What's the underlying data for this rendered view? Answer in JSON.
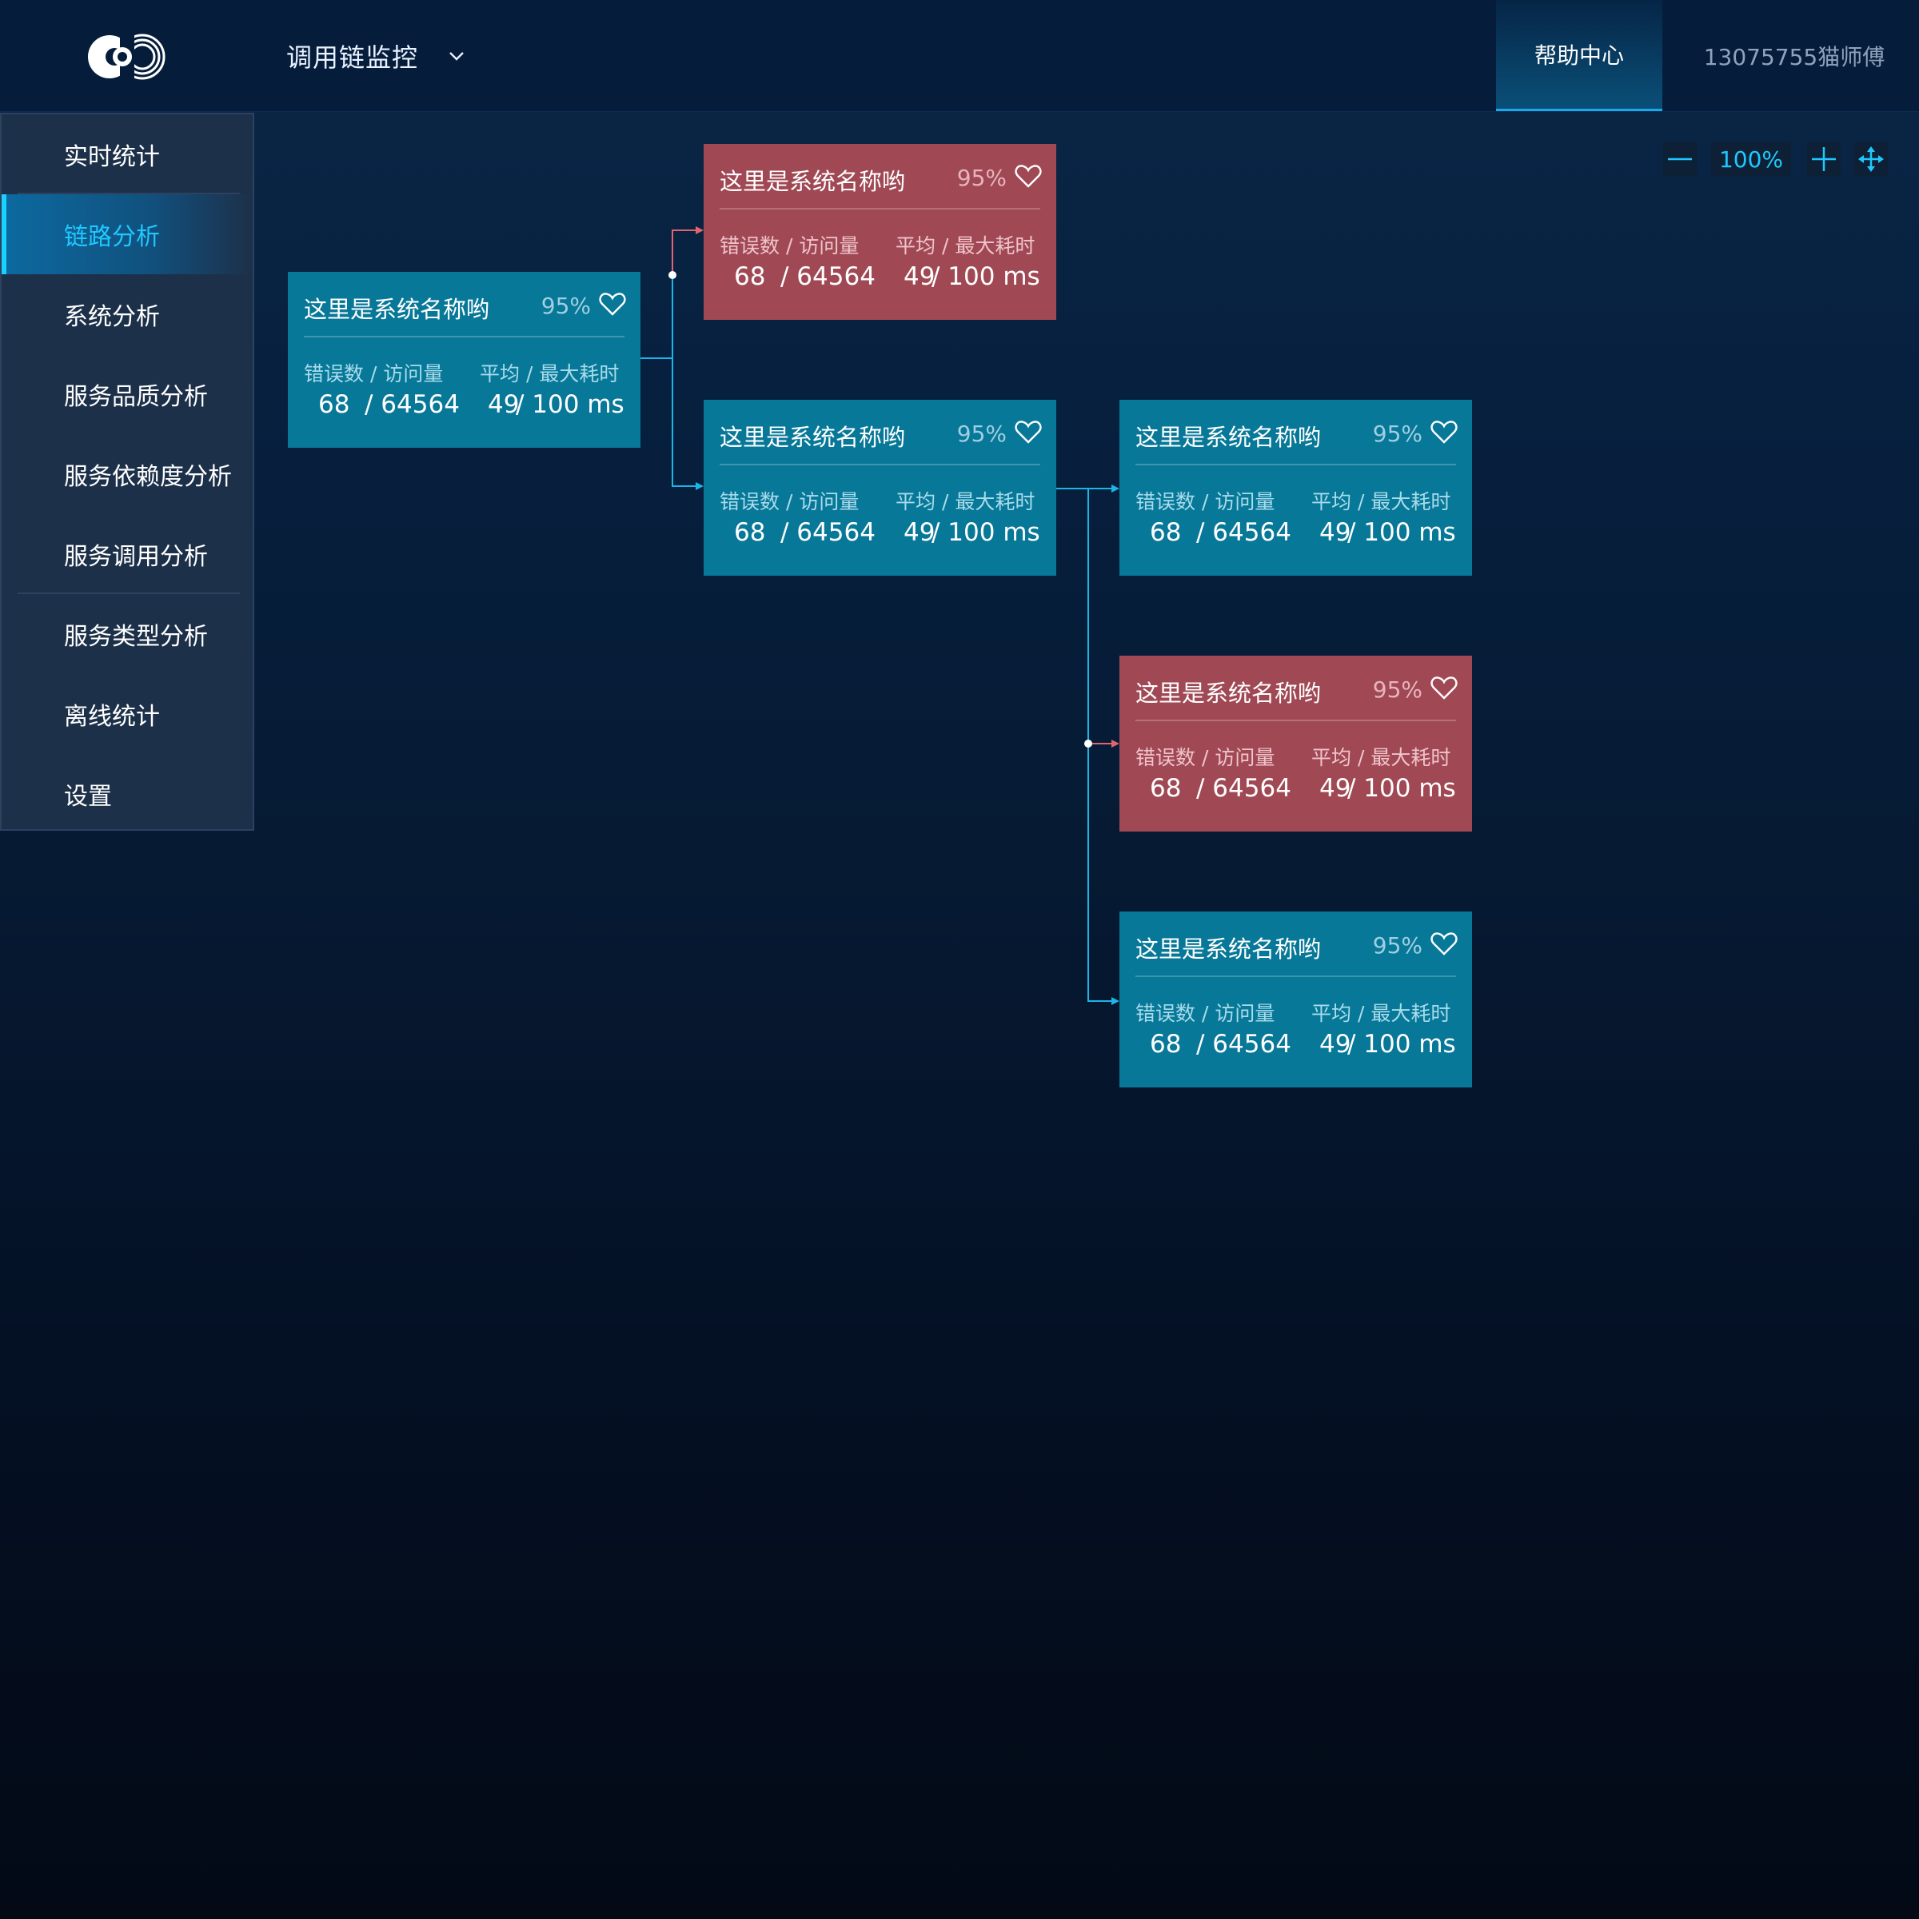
{
  "header": {
    "app_title": "调用链监控",
    "help": "帮助中心",
    "user": "13075755猫师傅"
  },
  "sidebar": {
    "items": [
      {
        "label": "实时统计"
      },
      {
        "label": "链路分析",
        "active": true
      },
      {
        "label": "系统分析"
      },
      {
        "label": "服务品质分析"
      },
      {
        "label": "服务依赖度分析"
      },
      {
        "label": "服务调用分析"
      },
      {
        "label": "服务类型分析"
      },
      {
        "label": "离线统计"
      },
      {
        "label": "设置"
      }
    ]
  },
  "zoom": {
    "value": "100%"
  },
  "colors": {
    "accent": "#1ec8ff",
    "healthy": "#087899",
    "error": "#a04955"
  },
  "nodes": [
    {
      "title": "这里是系统名称哟",
      "pct": "95%",
      "lbl1": "错误数 / 访问量",
      "lbl2": "平均 / 最大耗时",
      "errors": "68",
      "visits": "/ 64564",
      "avg": "49",
      "max": "/ 100 ms",
      "status": "healthy"
    },
    {
      "title": "这里是系统名称哟",
      "pct": "95%",
      "lbl1": "错误数 / 访问量",
      "lbl2": "平均 / 最大耗时",
      "errors": "68",
      "visits": "/ 64564",
      "avg": "49",
      "max": "/ 100 ms",
      "status": "error"
    },
    {
      "title": "这里是系统名称哟",
      "pct": "95%",
      "lbl1": "错误数 / 访问量",
      "lbl2": "平均 / 最大耗时",
      "errors": "68",
      "visits": "/ 64564",
      "avg": "49",
      "max": "/ 100 ms",
      "status": "healthy"
    },
    {
      "title": "这里是系统名称哟",
      "pct": "95%",
      "lbl1": "错误数 / 访问量",
      "lbl2": "平均 / 最大耗时",
      "errors": "68",
      "visits": "/ 64564",
      "avg": "49",
      "max": "/ 100 ms",
      "status": "healthy"
    },
    {
      "title": "这里是系统名称哟",
      "pct": "95%",
      "lbl1": "错误数 / 访问量",
      "lbl2": "平均 / 最大耗时",
      "errors": "68",
      "visits": "/ 64564",
      "avg": "49",
      "max": "/ 100 ms",
      "status": "error"
    },
    {
      "title": "这里是系统名称哟",
      "pct": "95%",
      "lbl1": "错误数 / 访问量",
      "lbl2": "平均 / 最大耗时",
      "errors": "68",
      "visits": "/ 64564",
      "avg": "49",
      "max": "/ 100 ms",
      "status": "healthy"
    }
  ]
}
